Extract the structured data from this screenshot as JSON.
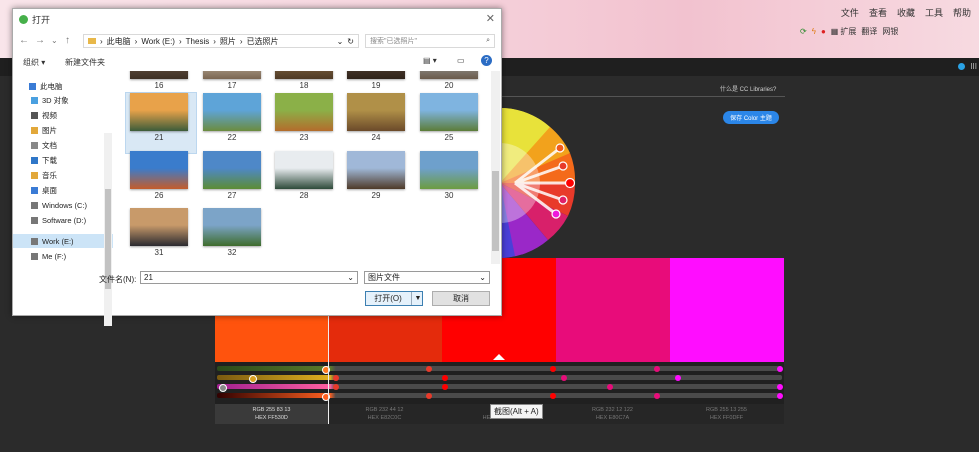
{
  "browser": {
    "menu": [
      "文件",
      "查看",
      "收藏",
      "工具",
      "帮助"
    ],
    "toolbar": {
      "extensions": "扩展",
      "item1": "翻译",
      "item2": "网银"
    }
  },
  "app": {
    "header_text": "III",
    "cc_libraries": "什么是 CC Libraries?",
    "save_button": "保存 Color 主题",
    "tooltip": "截图(Alt + A)",
    "swatches": [
      {
        "color": "#FF530D",
        "rgb": "RGB 255 83 13",
        "hex": "HEX FF530D"
      },
      {
        "color": "#E42B0C",
        "rgb": "RGB 232 44 12",
        "hex": "HEX E82C0C"
      },
      {
        "color": "#FF0000",
        "rgb": "RGB",
        "hex": "HEX FF0000"
      },
      {
        "color": "#E80C7A",
        "rgb": "RGB 232 12 122",
        "hex": "HEX E80C7A"
      },
      {
        "color": "#FF0DFF",
        "rgb": "RGB 255 13 255",
        "hex": "HEX FF0DFF"
      }
    ]
  },
  "dialog": {
    "title": "打开",
    "breadcrumb": [
      "此电脑",
      "Work (E:)",
      "Thesis",
      "照片",
      "已选照片"
    ],
    "search_placeholder": "搜索\"已选照片\"",
    "organize": "组织 ▾",
    "new_folder": "新建文件夹",
    "sidebar": [
      {
        "label": "此电脑",
        "icon": "computer-icon",
        "color": "#3a7bd5"
      },
      {
        "label": "3D 对象",
        "icon": "cube-icon",
        "color": "#4aa0e0"
      },
      {
        "label": "视频",
        "icon": "video-icon",
        "color": "#555555"
      },
      {
        "label": "图片",
        "icon": "picture-icon",
        "color": "#e2a83a"
      },
      {
        "label": "文档",
        "icon": "document-icon",
        "color": "#888888"
      },
      {
        "label": "下载",
        "icon": "download-icon",
        "color": "#2f77c8"
      },
      {
        "label": "音乐",
        "icon": "music-icon",
        "color": "#e2a83a"
      },
      {
        "label": "桌面",
        "icon": "desktop-icon",
        "color": "#3a7bd5"
      },
      {
        "label": "Windows (C:)",
        "icon": "drive-icon",
        "color": "#777777"
      },
      {
        "label": "Software (D:)",
        "icon": "drive-icon",
        "color": "#777777"
      },
      {
        "label": "Work (E:)",
        "icon": "drive-icon",
        "color": "#777777"
      },
      {
        "label": "Me (F:)",
        "icon": "drive-icon",
        "color": "#777777"
      }
    ],
    "thumbs": [
      {
        "label": "16",
        "c1": "#6b5a48",
        "c2": "#3d2f24"
      },
      {
        "label": "17",
        "c1": "#c8b9a6",
        "c2": "#7a6652"
      },
      {
        "label": "18",
        "c1": "#8c6d48",
        "c2": "#4e3a26"
      },
      {
        "label": "19",
        "c1": "#5c4a3a",
        "c2": "#2e2219"
      },
      {
        "label": "20",
        "c1": "#9fa6a8",
        "c2": "#6a5a4b"
      },
      {
        "label": "21",
        "c1": "#e8a24a",
        "c2": "#3c5c3a"
      },
      {
        "label": "22",
        "c1": "#5ea4d8",
        "c2": "#6b8c3e"
      },
      {
        "label": "23",
        "c1": "#8bb048",
        "c2": "#b46c2c"
      },
      {
        "label": "24",
        "c1": "#b09048",
        "c2": "#6b4a2a"
      },
      {
        "label": "25",
        "c1": "#7fb4e0",
        "c2": "#5c7c38"
      },
      {
        "label": "26",
        "c1": "#3a7ccc",
        "c2": "#c45c2a"
      },
      {
        "label": "27",
        "c1": "#4e88c8",
        "c2": "#5c8c34"
      },
      {
        "label": "28",
        "c1": "#e8ecef",
        "c2": "#2e4a3a"
      },
      {
        "label": "29",
        "c1": "#a0b8d8",
        "c2": "#4e3a28"
      },
      {
        "label": "30",
        "c1": "#6ea0cc",
        "c2": "#6c9c40"
      },
      {
        "label": "31",
        "c1": "#c89a6a",
        "c2": "#2a2a30"
      },
      {
        "label": "32",
        "c1": "#7ca4c8",
        "c2": "#3e6c2c"
      }
    ],
    "filename_label": "文件名(N):",
    "filename_value": "21",
    "filetype": "图片文件",
    "open_button": "打开(O)",
    "cancel_button": "取消"
  }
}
